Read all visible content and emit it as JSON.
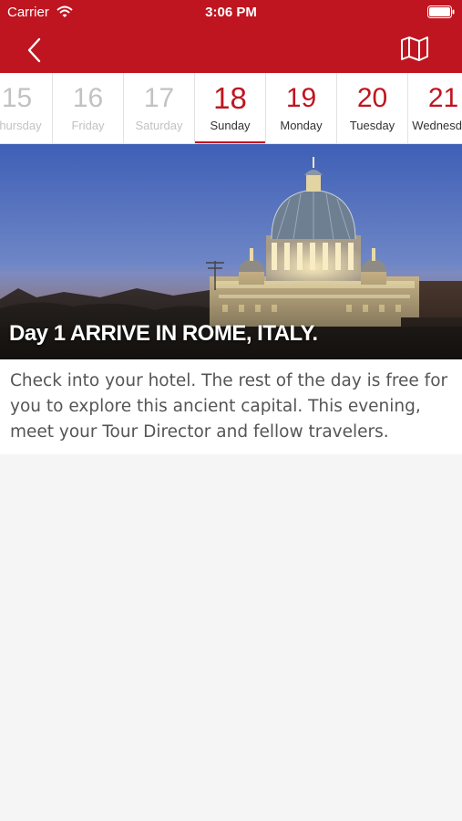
{
  "status_bar": {
    "carrier": "Carrier",
    "time": "3:06 PM"
  },
  "colors": {
    "brand_red": "#bf1520",
    "past_gray": "#c2c2c2"
  },
  "header": {
    "back_icon": "chevron-left-icon",
    "map_icon": "map-icon"
  },
  "dates": [
    {
      "num": "15",
      "day": "Thursday",
      "state": "past"
    },
    {
      "num": "16",
      "day": "Friday",
      "state": "past"
    },
    {
      "num": "17",
      "day": "Saturday",
      "state": "past"
    },
    {
      "num": "18",
      "day": "Sunday",
      "state": "selected"
    },
    {
      "num": "19",
      "day": "Monday",
      "state": "future"
    },
    {
      "num": "20",
      "day": "Tuesday",
      "state": "future"
    },
    {
      "num": "21",
      "day": "Wednesday",
      "state": "future"
    }
  ],
  "itinerary": {
    "title": "Day 1 ARRIVE IN ROME, ITALY.",
    "description": "Check into your hotel. The rest of the day is free for you to explore this ancient capital. This evening, meet your Tour Director and fellow travelers."
  }
}
